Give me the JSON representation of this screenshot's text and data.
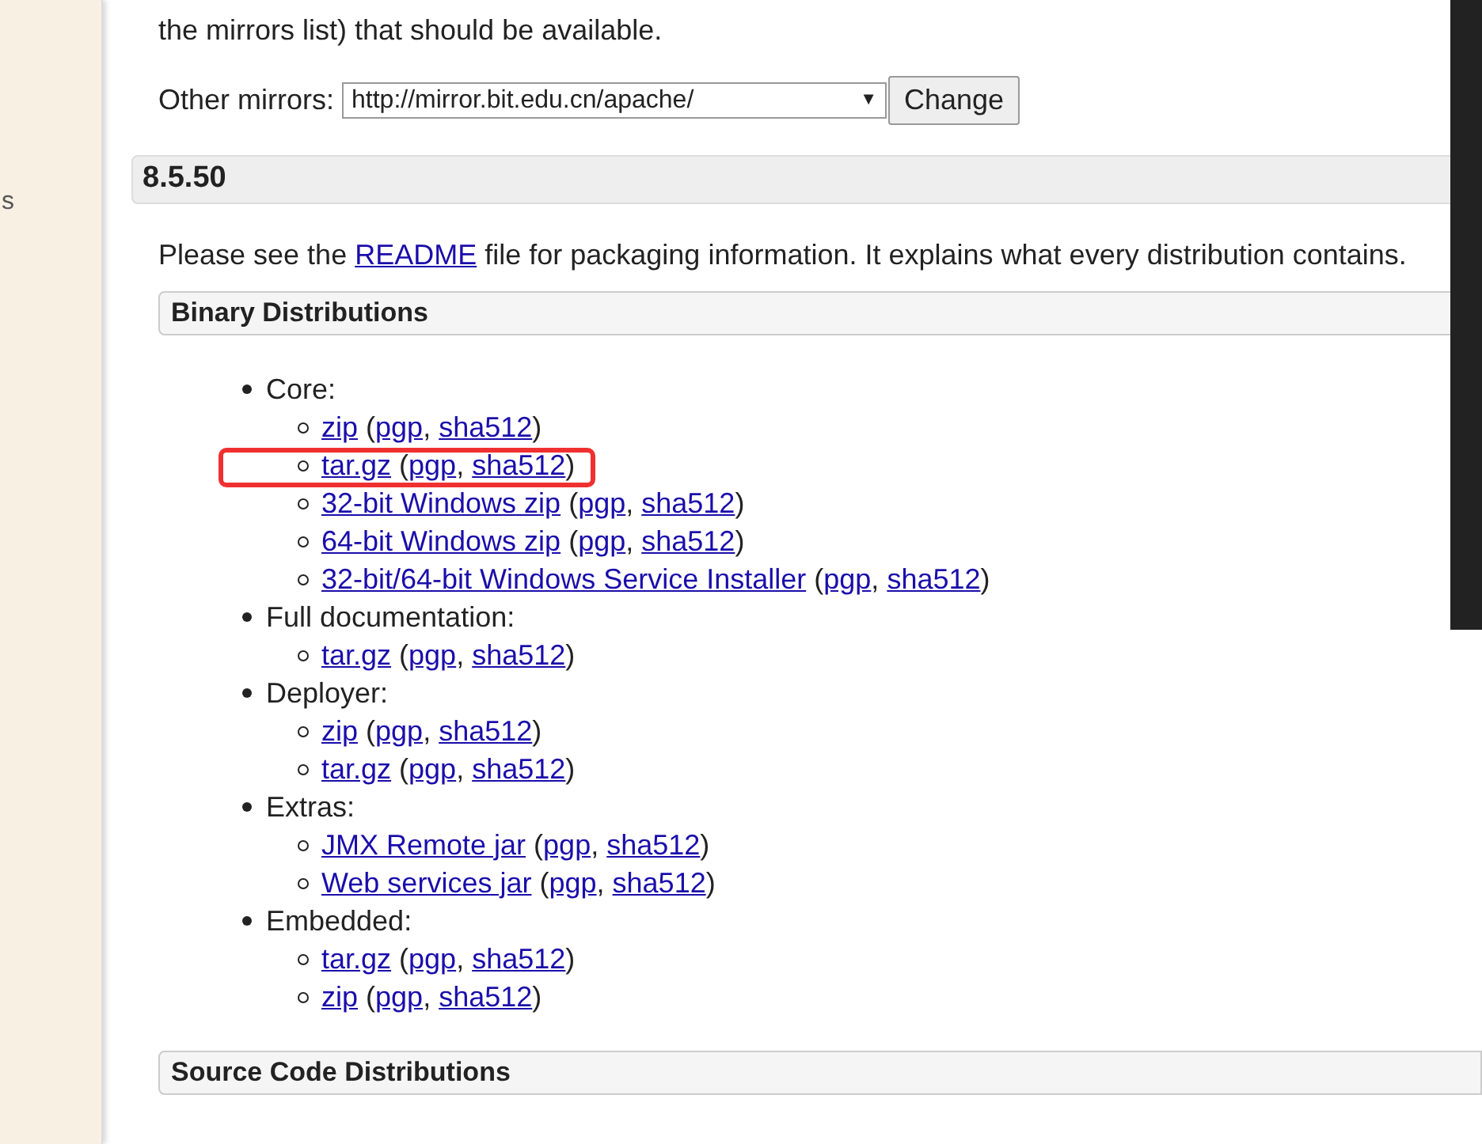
{
  "sidebar": {
    "text": "s"
  },
  "intro": {
    "text": "the mirrors list) that should be available."
  },
  "mirrors": {
    "label": "Other mirrors:",
    "value": "http://mirror.bit.edu.cn/apache/",
    "arrow": "▼",
    "button": "Change"
  },
  "version_heading": "8.5.50",
  "readme_note": [
    {
      "kind": "text",
      "text": "Please see the "
    },
    {
      "kind": "link",
      "text": "README"
    },
    {
      "kind": "text",
      "text": " file for packaging information. It explains what every distribution contains."
    }
  ],
  "binary_heading": "Binary Distributions",
  "groups": [
    {
      "label": "Core:",
      "items": [
        {
          "highlighted": false,
          "parts": [
            {
              "kind": "link",
              "text": "zip"
            },
            {
              "kind": "text",
              "text": " ("
            },
            {
              "kind": "link",
              "text": "pgp"
            },
            {
              "kind": "text",
              "text": ", "
            },
            {
              "kind": "link",
              "text": "sha512"
            },
            {
              "kind": "text",
              "text": ")"
            }
          ]
        },
        {
          "highlighted": true,
          "parts": [
            {
              "kind": "link",
              "text": "tar.gz"
            },
            {
              "kind": "text",
              "text": " ("
            },
            {
              "kind": "link",
              "text": "pgp"
            },
            {
              "kind": "text",
              "text": ", "
            },
            {
              "kind": "link",
              "text": "sha512"
            },
            {
              "kind": "text",
              "text": ")"
            }
          ]
        },
        {
          "highlighted": false,
          "parts": [
            {
              "kind": "link",
              "text": "32-bit Windows zip"
            },
            {
              "kind": "text",
              "text": " ("
            },
            {
              "kind": "link",
              "text": "pgp"
            },
            {
              "kind": "text",
              "text": ", "
            },
            {
              "kind": "link",
              "text": "sha512"
            },
            {
              "kind": "text",
              "text": ")"
            }
          ]
        },
        {
          "highlighted": false,
          "parts": [
            {
              "kind": "link",
              "text": "64-bit Windows zip"
            },
            {
              "kind": "text",
              "text": " ("
            },
            {
              "kind": "link",
              "text": "pgp"
            },
            {
              "kind": "text",
              "text": ", "
            },
            {
              "kind": "link",
              "text": "sha512"
            },
            {
              "kind": "text",
              "text": ")"
            }
          ]
        },
        {
          "highlighted": false,
          "parts": [
            {
              "kind": "link",
              "text": "32-bit/64-bit Windows Service Installer"
            },
            {
              "kind": "text",
              "text": " ("
            },
            {
              "kind": "link",
              "text": "pgp"
            },
            {
              "kind": "text",
              "text": ", "
            },
            {
              "kind": "link",
              "text": "sha512"
            },
            {
              "kind": "text",
              "text": ")"
            }
          ]
        }
      ]
    },
    {
      "label": "Full documentation:",
      "items": [
        {
          "highlighted": false,
          "parts": [
            {
              "kind": "link",
              "text": "tar.gz"
            },
            {
              "kind": "text",
              "text": " ("
            },
            {
              "kind": "link",
              "text": "pgp"
            },
            {
              "kind": "text",
              "text": ", "
            },
            {
              "kind": "link",
              "text": "sha512"
            },
            {
              "kind": "text",
              "text": ")"
            }
          ]
        }
      ]
    },
    {
      "label": "Deployer:",
      "items": [
        {
          "highlighted": false,
          "parts": [
            {
              "kind": "link",
              "text": "zip"
            },
            {
              "kind": "text",
              "text": " ("
            },
            {
              "kind": "link",
              "text": "pgp"
            },
            {
              "kind": "text",
              "text": ", "
            },
            {
              "kind": "link",
              "text": "sha512"
            },
            {
              "kind": "text",
              "text": ")"
            }
          ]
        },
        {
          "highlighted": false,
          "parts": [
            {
              "kind": "link",
              "text": "tar.gz"
            },
            {
              "kind": "text",
              "text": " ("
            },
            {
              "kind": "link",
              "text": "pgp"
            },
            {
              "kind": "text",
              "text": ", "
            },
            {
              "kind": "link",
              "text": "sha512"
            },
            {
              "kind": "text",
              "text": ")"
            }
          ]
        }
      ]
    },
    {
      "label": "Extras:",
      "items": [
        {
          "highlighted": false,
          "parts": [
            {
              "kind": "link",
              "text": "JMX Remote jar"
            },
            {
              "kind": "text",
              "text": " ("
            },
            {
              "kind": "link",
              "text": "pgp"
            },
            {
              "kind": "text",
              "text": ", "
            },
            {
              "kind": "link",
              "text": "sha512"
            },
            {
              "kind": "text",
              "text": ")"
            }
          ]
        },
        {
          "highlighted": false,
          "parts": [
            {
              "kind": "link",
              "text": "Web services jar"
            },
            {
              "kind": "text",
              "text": " ("
            },
            {
              "kind": "link",
              "text": "pgp"
            },
            {
              "kind": "text",
              "text": ", "
            },
            {
              "kind": "link",
              "text": "sha512"
            },
            {
              "kind": "text",
              "text": ")"
            }
          ]
        }
      ]
    },
    {
      "label": "Embedded:",
      "items": [
        {
          "highlighted": false,
          "parts": [
            {
              "kind": "link",
              "text": "tar.gz"
            },
            {
              "kind": "text",
              "text": " ("
            },
            {
              "kind": "link",
              "text": "pgp"
            },
            {
              "kind": "text",
              "text": ", "
            },
            {
              "kind": "link",
              "text": "sha512"
            },
            {
              "kind": "text",
              "text": ")"
            }
          ]
        },
        {
          "highlighted": false,
          "parts": [
            {
              "kind": "link",
              "text": "zip"
            },
            {
              "kind": "text",
              "text": " ("
            },
            {
              "kind": "link",
              "text": "pgp"
            },
            {
              "kind": "text",
              "text": ", "
            },
            {
              "kind": "link",
              "text": "sha512"
            },
            {
              "kind": "text",
              "text": ")"
            }
          ]
        }
      ]
    }
  ],
  "source_heading": "Source Code Distributions"
}
